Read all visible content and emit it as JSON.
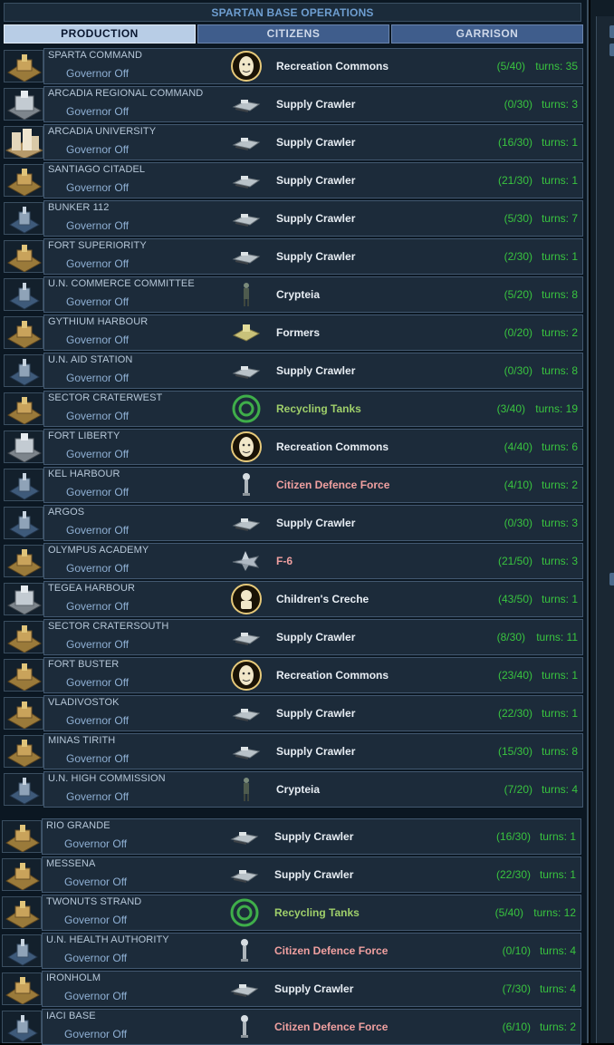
{
  "title": "SPARTAN BASE OPERATIONS",
  "tabs": [
    {
      "label": "PRODUCTION",
      "active": true
    },
    {
      "label": "CITIZENS",
      "active": false
    },
    {
      "label": "GARRISON",
      "active": false
    }
  ],
  "colors": {
    "progress": "#39c43f",
    "item_white": "#e8eef4",
    "item_green": "#9fcf6a",
    "item_pink": "#f0a0a0"
  },
  "bases": [
    {
      "name": "SPARTA COMMAND",
      "governor": "Governor Off",
      "item": "Recreation Commons",
      "item_icon": "face-icon",
      "item_color": "white",
      "progress": "(5/40)",
      "turns": "turns:  35",
      "base_icon": "gold"
    },
    {
      "name": "ARCADIA REGIONAL COMMAND",
      "governor": "Governor Off",
      "item": "Supply Crawler",
      "item_icon": "crawler-icon",
      "item_color": "white",
      "progress": "(0/30)",
      "turns": "turns:  3",
      "base_icon": "silver"
    },
    {
      "name": "ARCADIA UNIVERSITY",
      "governor": "Governor Off",
      "item": "Supply Crawler",
      "item_icon": "crawler-icon",
      "item_color": "white",
      "progress": "(16/30)",
      "turns": "turns:  1",
      "base_icon": "tower"
    },
    {
      "name": "SANTIAGO CITADEL",
      "governor": "Governor Off",
      "item": "Supply Crawler",
      "item_icon": "crawler-icon",
      "item_color": "white",
      "progress": "(21/30)",
      "turns": "turns:  1",
      "base_icon": "gold"
    },
    {
      "name": "BUNKER 112",
      "governor": "Governor Off",
      "item": "Supply Crawler",
      "item_icon": "crawler-icon",
      "item_color": "white",
      "progress": "(5/30)",
      "turns": "turns:  7",
      "base_icon": "blue"
    },
    {
      "name": "FORT SUPERIORITY",
      "governor": "Governor Off",
      "item": "Supply Crawler",
      "item_icon": "crawler-icon",
      "item_color": "white",
      "progress": "(2/30)",
      "turns": "turns:  1",
      "base_icon": "gold"
    },
    {
      "name": "U.N. COMMERCE COMMITTEE",
      "governor": "Governor Off",
      "item": "Crypteia",
      "item_icon": "soldier-icon",
      "item_color": "white",
      "progress": "(5/20)",
      "turns": "turns:  8",
      "base_icon": "blue"
    },
    {
      "name": "GYTHIUM HARBOUR",
      "governor": "Governor Off",
      "item": "Formers",
      "item_icon": "former-icon",
      "item_color": "white",
      "progress": "(0/20)",
      "turns": "turns:  2",
      "base_icon": "gold"
    },
    {
      "name": "U.N. AID STATION",
      "governor": "Governor Off",
      "item": "Supply Crawler",
      "item_icon": "crawler-icon",
      "item_color": "white",
      "progress": "(0/30)",
      "turns": "turns:  8",
      "base_icon": "blue"
    },
    {
      "name": "SECTOR CRATERWEST",
      "governor": "Governor Off",
      "item": "Recycling Tanks",
      "item_icon": "recycle-icon",
      "item_color": "green",
      "progress": "(3/40)",
      "turns": "turns:  19",
      "base_icon": "gold"
    },
    {
      "name": "FORT LIBERTY",
      "governor": "Governor Off",
      "item": "Recreation Commons",
      "item_icon": "face-icon",
      "item_color": "white",
      "progress": "(4/40)",
      "turns": "turns:  6",
      "base_icon": "silver"
    },
    {
      "name": "KEL HARBOUR",
      "governor": "Governor Off",
      "item": "Citizen Defence Force",
      "item_icon": "probe-icon",
      "item_color": "pink",
      "progress": "(4/10)",
      "turns": "turns:  2",
      "base_icon": "blue"
    },
    {
      "name": "ARGOS",
      "governor": "Governor Off",
      "item": "Supply Crawler",
      "item_icon": "crawler-icon",
      "item_color": "white",
      "progress": "(0/30)",
      "turns": "turns:  3",
      "base_icon": "blue"
    },
    {
      "name": "OLYMPUS ACADEMY",
      "governor": "Governor Off",
      "item": "F-6",
      "item_icon": "jet-icon",
      "item_color": "pink",
      "progress": "(21/50)",
      "turns": "turns:  3",
      "base_icon": "gold"
    },
    {
      "name": "TEGEA HARBOUR",
      "governor": "Governor Off",
      "item": "Children's Creche",
      "item_icon": "creche-icon",
      "item_color": "white",
      "progress": "(43/50)",
      "turns": "turns:  1",
      "base_icon": "silver"
    },
    {
      "name": "SECTOR CRATERSOUTH",
      "governor": "Governor Off",
      "item": "Supply Crawler",
      "item_icon": "crawler-icon",
      "item_color": "white",
      "progress": "(8/30)",
      "turns": "turns:  11",
      "base_icon": "gold"
    },
    {
      "name": "FORT BUSTER",
      "governor": "Governor Off",
      "item": "Recreation Commons",
      "item_icon": "face-icon",
      "item_color": "white",
      "progress": "(23/40)",
      "turns": "turns:  1",
      "base_icon": "gold"
    },
    {
      "name": "VLADIVOSTOK",
      "governor": "Governor Off",
      "item": "Supply Crawler",
      "item_icon": "crawler-icon",
      "item_color": "white",
      "progress": "(22/30)",
      "turns": "turns:  1",
      "base_icon": "gold"
    },
    {
      "name": "MINAS TIRITH",
      "governor": "Governor Off",
      "item": "Supply Crawler",
      "item_icon": "crawler-icon",
      "item_color": "white",
      "progress": "(15/30)",
      "turns": "turns:  8",
      "base_icon": "gold"
    },
    {
      "name": "U.N. HIGH COMMISSION",
      "governor": "Governor Off",
      "item": "Crypteia",
      "item_icon": "soldier-icon",
      "item_color": "white",
      "progress": "(7/20)",
      "turns": "turns:  4",
      "base_icon": "blue"
    },
    {
      "name": "RIO GRANDE",
      "governor": "Governor Off",
      "item": "Supply Crawler",
      "item_icon": "crawler-icon",
      "item_color": "white",
      "progress": "(16/30)",
      "turns": "turns:  1",
      "base_icon": "gold"
    },
    {
      "name": "MESSENA",
      "governor": "Governor Off",
      "item": "Supply Crawler",
      "item_icon": "crawler-icon",
      "item_color": "white",
      "progress": "(22/30)",
      "turns": "turns:  1",
      "base_icon": "gold"
    },
    {
      "name": "TWONUTS STRAND",
      "governor": "Governor Off",
      "item": "Recycling Tanks",
      "item_icon": "recycle-icon",
      "item_color": "green",
      "progress": "(5/40)",
      "turns": "turns:  12",
      "base_icon": "gold"
    },
    {
      "name": "U.N. HEALTH AUTHORITY",
      "governor": "Governor Off",
      "item": "Citizen Defence Force",
      "item_icon": "probe-icon",
      "item_color": "pink",
      "progress": "(0/10)",
      "turns": "turns:  4",
      "base_icon": "blue"
    },
    {
      "name": "IRONHOLM",
      "governor": "Governor Off",
      "item": "Supply Crawler",
      "item_icon": "crawler-icon",
      "item_color": "white",
      "progress": "(7/30)",
      "turns": "turns:  4",
      "base_icon": "gold"
    },
    {
      "name": "IACI BASE",
      "governor": "Governor Off",
      "item": "Citizen Defence Force",
      "item_icon": "probe-icon",
      "item_color": "pink",
      "progress": "(6/10)",
      "turns": "turns:  2",
      "base_icon": "blue"
    }
  ]
}
